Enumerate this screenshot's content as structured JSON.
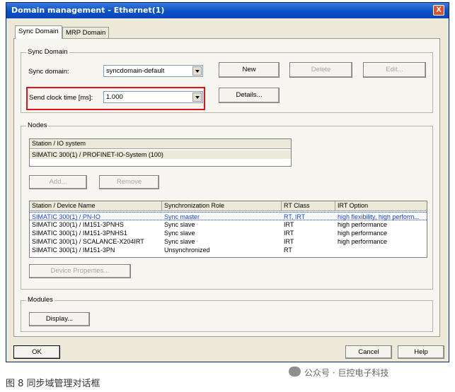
{
  "window": {
    "title": "Domain management - Ethernet(1)",
    "close_label": "X"
  },
  "tabs": [
    {
      "label": "Sync Domain"
    },
    {
      "label": "MRP Domain"
    }
  ],
  "sync_domain": {
    "group_label": "Sync Domain",
    "domain_label": "Sync domain:",
    "domain_value": "syncdomain-default",
    "new_label": "New",
    "delete_label": "Delete",
    "edit_label": "Edit...",
    "send_clock_label": "Send clock time [ms]:",
    "send_clock_value": "1.000",
    "details_label": "Details..."
  },
  "nodes": {
    "group_label": "Nodes",
    "station_header": "Station / IO system",
    "station_rows": [
      "SIMATIC 300(1) / PROFINET-IO-System (100)"
    ],
    "add_label": "Add...",
    "remove_label": "Remove",
    "device_columns": [
      "Station / Device Name",
      "Synchronization Role",
      "RT Class",
      "IRT Option"
    ],
    "device_rows": [
      {
        "name": "SIMATIC 300(1) / PN-IO",
        "role": "Sync master",
        "rt": "RT, IRT",
        "irt": "high flexibility, high perform..."
      },
      {
        "name": "SIMATIC 300(1) / IM151-3PNHS",
        "role": "Sync slave",
        "rt": "IRT",
        "irt": "high performance"
      },
      {
        "name": "SIMATIC 300(1) / IM151-3PNHS1",
        "role": "Sync slave",
        "rt": "IRT",
        "irt": "high performance"
      },
      {
        "name": "SIMATIC 300(1) / SCALANCE-X204IRT",
        "role": "Sync slave",
        "rt": "IRT",
        "irt": "high performance"
      },
      {
        "name": "SIMATIC 300(1) / IM151-3PN",
        "role": "Unsynchronized",
        "rt": "RT",
        "irt": ""
      }
    ],
    "device_properties_label": "Device Properties..."
  },
  "modules": {
    "group_label": "Modules",
    "display_label": "Display..."
  },
  "footer": {
    "ok_label": "OK",
    "cancel_label": "Cancel",
    "help_label": "Help"
  },
  "caption": "图 8 同步域管理对话框",
  "watermark": "公众号 · 巨控电子科技"
}
